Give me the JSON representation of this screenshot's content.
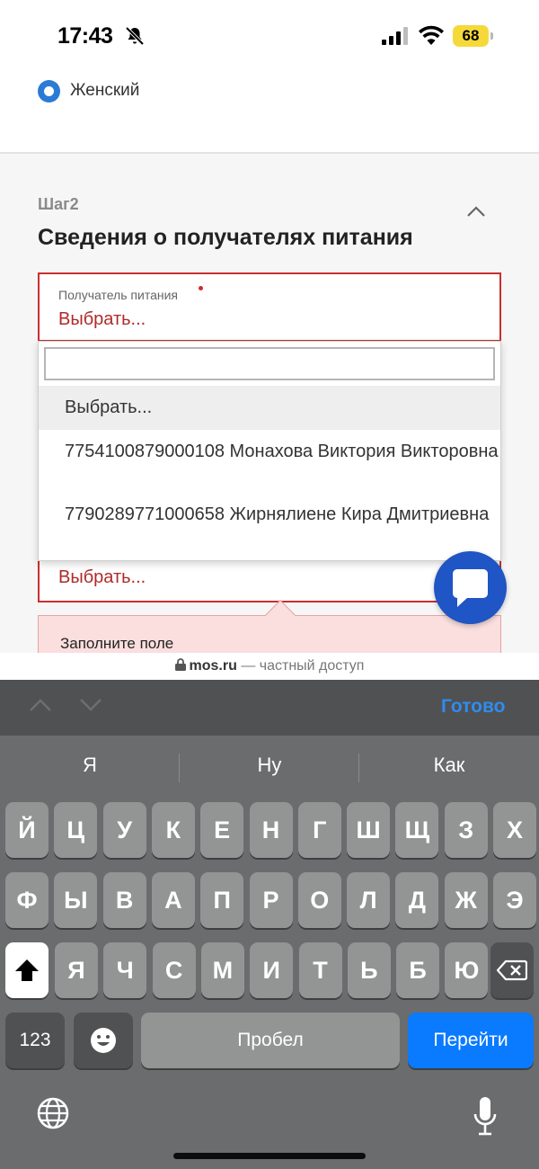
{
  "status_bar": {
    "time": "17:43",
    "battery": "68"
  },
  "form": {
    "gender_option": "Женский",
    "step_label": "Шаг2",
    "section_title": "Сведения о получателях питания",
    "recipient_field": {
      "caption": "Получатель питания",
      "value": "Выбрать..."
    },
    "dropdown": {
      "search_value": "",
      "options": [
        "Выбрать...",
        "7754100879000108 Монахова Виктория Викторовна",
        "7790289771000658 Жирнялиене Кира Дмитриевна"
      ],
      "selected_index": 0
    },
    "second_field": {
      "value": "Выбрать..."
    },
    "error_text": "Заполните поле"
  },
  "browser": {
    "host": "mos.ru",
    "note": "— частный доступ"
  },
  "keyboard": {
    "done_label": "Готово",
    "suggestions": [
      "Я",
      "Ну",
      "Как"
    ],
    "row1": [
      "Й",
      "Ц",
      "У",
      "К",
      "Е",
      "Н",
      "Г",
      "Ш",
      "Щ",
      "З",
      "Х"
    ],
    "row2": [
      "Ф",
      "Ы",
      "В",
      "А",
      "П",
      "Р",
      "О",
      "Л",
      "Д",
      "Ж",
      "Э"
    ],
    "row3": [
      "Я",
      "Ч",
      "С",
      "М",
      "И",
      "Т",
      "Ь",
      "Б",
      "Ю"
    ],
    "numbers_label": "123",
    "space_label": "Пробел",
    "go_label": "Перейти"
  },
  "colors": {
    "accent_red": "#c8302f",
    "chat_blue": "#1f55c4",
    "keyboard_blue": "#0a7aff"
  }
}
